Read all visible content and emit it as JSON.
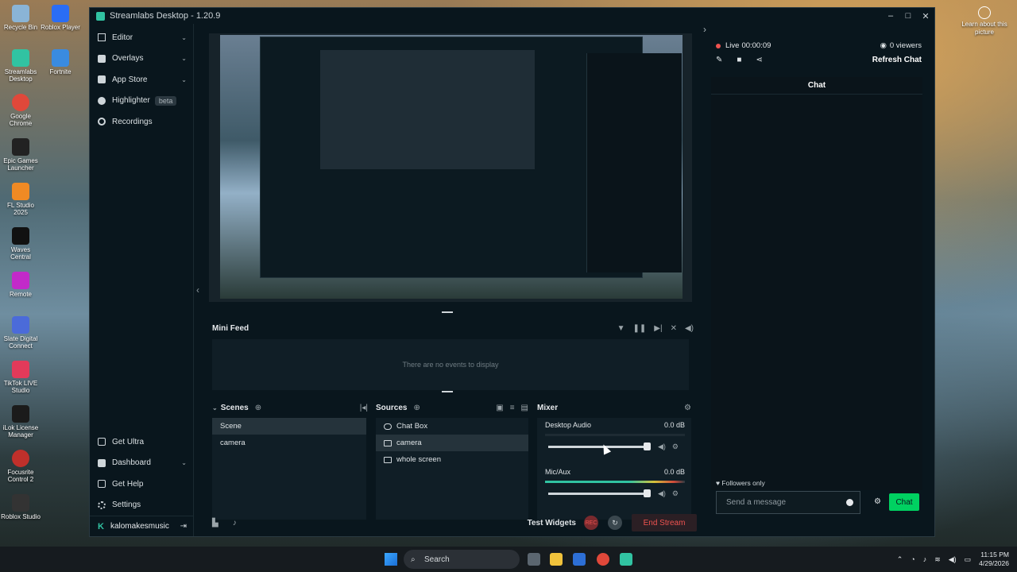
{
  "desktop": {
    "icons": [
      {
        "label": "Recycle Bin"
      },
      {
        "label": "Roblox Player"
      },
      {
        "label": "Streamlabs Desktop"
      },
      {
        "label": "Fortnite"
      },
      {
        "label": "Google Chrome"
      },
      {
        "label": "Epic Games Launcher"
      },
      {
        "label": "FL Studio 2025"
      },
      {
        "label": "Waves Central"
      },
      {
        "label": "Remote"
      },
      {
        "label": "Slate Digital Connect"
      },
      {
        "label": "TikTok LIVE Studio"
      },
      {
        "label": "iLok License Manager"
      },
      {
        "label": "Focusrite Control 2"
      },
      {
        "label": "Roblox Studio"
      }
    ],
    "learn_label": "Learn about this picture"
  },
  "window": {
    "title": "Streamlabs Desktop - 1.20.9",
    "controls": [
      "–",
      "□",
      "✕"
    ]
  },
  "sidebar": {
    "items": [
      {
        "label": "Editor",
        "chevron": "⌄"
      },
      {
        "label": "Overlays",
        "chevron": "⌄"
      },
      {
        "label": "App Store",
        "chevron": "⌄"
      },
      {
        "label": "Highlighter",
        "badge": "beta"
      },
      {
        "label": "Recordings"
      }
    ],
    "bottom_items": [
      {
        "label": "Get Ultra"
      },
      {
        "label": "Dashboard",
        "chevron": "⌄"
      },
      {
        "label": "Get Help"
      },
      {
        "label": "Settings"
      }
    ],
    "username": "kalomakesmusic"
  },
  "minifeed": {
    "title": "Mini Feed",
    "empty_text": "There are no events to display"
  },
  "scenes": {
    "title": "Scenes",
    "items": [
      {
        "label": "Scene",
        "selected": true
      },
      {
        "label": "camera",
        "selected": false
      }
    ]
  },
  "sources": {
    "title": "Sources",
    "items": [
      {
        "label": "Chat Box",
        "selected": false
      },
      {
        "label": "camera",
        "selected": true
      },
      {
        "label": "whole screen",
        "selected": false
      }
    ]
  },
  "mixer": {
    "title": "Mixer",
    "channels": [
      {
        "name": "Desktop Audio",
        "level": "0.0 dB",
        "fader": 0.95,
        "active": false
      },
      {
        "name": "Mic/Aux",
        "level": "0.0 dB",
        "fader": 0.95,
        "active": true
      }
    ]
  },
  "footer": {
    "test_widgets": "Test Widgets",
    "rec_label": "REC",
    "end_stream": "End Stream"
  },
  "chat": {
    "live_label": "Live",
    "live_time": "00:00:09",
    "viewers": "0 viewers",
    "refresh": "Refresh Chat",
    "title": "Chat",
    "followers_only": "Followers only",
    "placeholder": "Send a message",
    "send": "Chat"
  },
  "taskbar": {
    "search_placeholder": "Search",
    "time": "11:15 PM",
    "date": "4/29/2026"
  },
  "colors": {
    "accent": "#31c3a2",
    "live_red": "#ef5350",
    "chat_green": "#00d161",
    "bg": "#09161d"
  }
}
